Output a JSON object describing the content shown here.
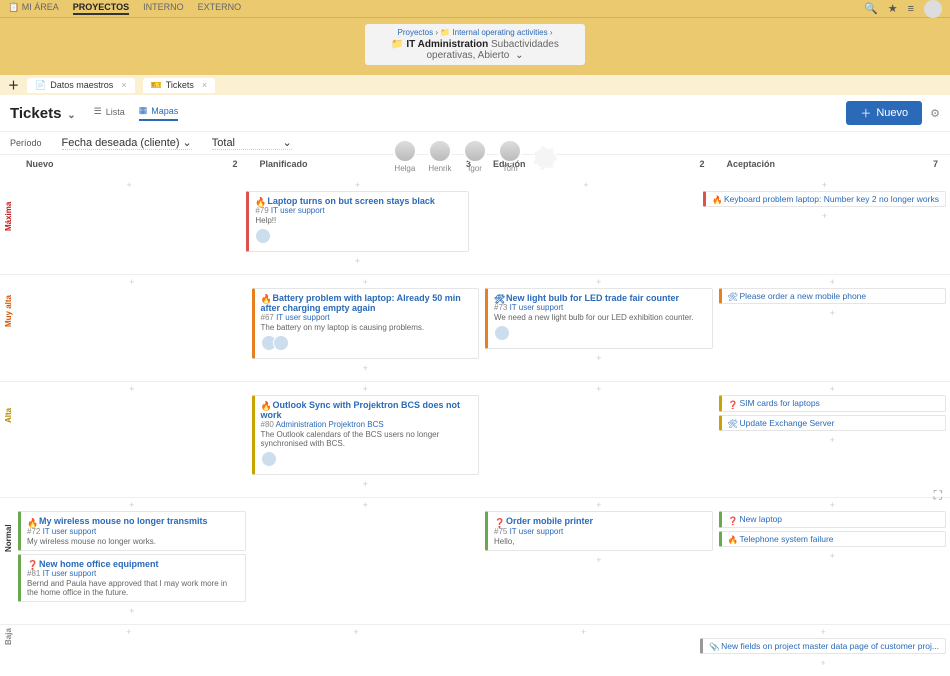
{
  "topnav": {
    "items": [
      "MI ÁREA",
      "PROYECTOS",
      "INTERNO",
      "EXTERNO"
    ],
    "active": 1
  },
  "breadcrumb": {
    "root": "Proyectos",
    "mid": "Internal operating activities",
    "project_label": "IT Administration",
    "project_sub": "Subactividades operativas, Abierto"
  },
  "tabs": {
    "items": [
      {
        "label": "Datos maestros",
        "icon": "📄"
      },
      {
        "label": "Tickets",
        "icon": "🎫"
      }
    ],
    "active": 1
  },
  "header": {
    "title": "Tickets",
    "view_list": "Lista",
    "view_map": "Mapas",
    "new_btn": "Nuevo"
  },
  "filters": {
    "period_label": "Período",
    "date_label": "Fecha deseada (cliente)",
    "total_label": "Total"
  },
  "people": [
    "Helga",
    "Henrik",
    "Igor",
    "Tom",
    ""
  ],
  "columns": [
    {
      "title": "Nuevo",
      "count": "2"
    },
    {
      "title": "Planificado",
      "count": "3"
    },
    {
      "title": "Edición",
      "count": "2"
    },
    {
      "title": "Aceptación",
      "count": "7"
    }
  ],
  "rows": [
    "Máxima",
    "Muy alta",
    "Alta",
    "Normal",
    "Baja"
  ],
  "cards": {
    "r0c1": [
      {
        "color": "#d9534f",
        "icon": "🔥",
        "title": "Laptop turns on but screen stays black",
        "id": "#79",
        "dept": "IT user support",
        "body": "Help!!",
        "avatars": 1
      }
    ],
    "r0c3": [
      {
        "color": "#d9534f",
        "icon": "🔥",
        "title": "Keyboard problem laptop: Number key 2 no longer works",
        "compact": true
      }
    ],
    "r1c1": [
      {
        "color": "#e67e22",
        "icon": "🔥",
        "title": "Battery problem with laptop: Already 50 min after charging empty again",
        "id": "#67",
        "dept": "IT user support",
        "body": "The battery on my laptop is causing problems.",
        "avatars": 2
      }
    ],
    "r1c2": [
      {
        "color": "#e67e22",
        "icon": "🛠",
        "title": "New light bulb for LED trade fair counter",
        "id": "#73",
        "dept": "IT user support",
        "body": "We need a new light bulb for our LED exhibition counter.",
        "avatars": 1
      }
    ],
    "r1c3": [
      {
        "color": "#e67e22",
        "icon": "🛠",
        "title": "Please order a new mobile phone",
        "compact": true
      }
    ],
    "r2c1": [
      {
        "color": "#c9a400",
        "icon": "🔥",
        "title": "Outlook Sync with Projektron BCS does not work",
        "id": "#80",
        "dept": "Administration Projektron BCS",
        "body": "The Outlook calendars of the BCS users no longer synchronised with BCS.",
        "avatars": 1
      }
    ],
    "r2c3": [
      {
        "color": "#c9a400",
        "icon": "❓",
        "title": "SIM cards for laptops",
        "compact": true
      },
      {
        "color": "#c9a400",
        "icon": "🛠",
        "title": "Update Exchange Server",
        "compact": true
      }
    ],
    "r3c0": [
      {
        "color": "#6aa84f",
        "icon": "🔥",
        "title": "My wireless mouse no longer transmits",
        "id": "#72",
        "dept": "IT user support",
        "body": "My wireless mouse no longer works."
      },
      {
        "color": "#6aa84f",
        "icon": "❓",
        "title": "New home office equipment",
        "id": "#81",
        "dept": "IT user support",
        "body": "Bernd and Paula have approved that I may work more in the home office in the future."
      }
    ],
    "r3c2": [
      {
        "color": "#6aa84f",
        "icon": "❓",
        "title": "Order mobile printer",
        "id": "#75",
        "dept": "IT user support",
        "body": "Hello,"
      }
    ],
    "r3c3": [
      {
        "color": "#6aa84f",
        "icon": "❓",
        "title": "New laptop",
        "compact": true
      },
      {
        "color": "#6aa84f",
        "icon": "🔥",
        "title": "Telephone system failure",
        "compact": true
      }
    ],
    "r4c3": [
      {
        "color": "#999",
        "icon": "📎",
        "title": "New fields on project master data page of customer proj...",
        "compact": true
      }
    ]
  }
}
